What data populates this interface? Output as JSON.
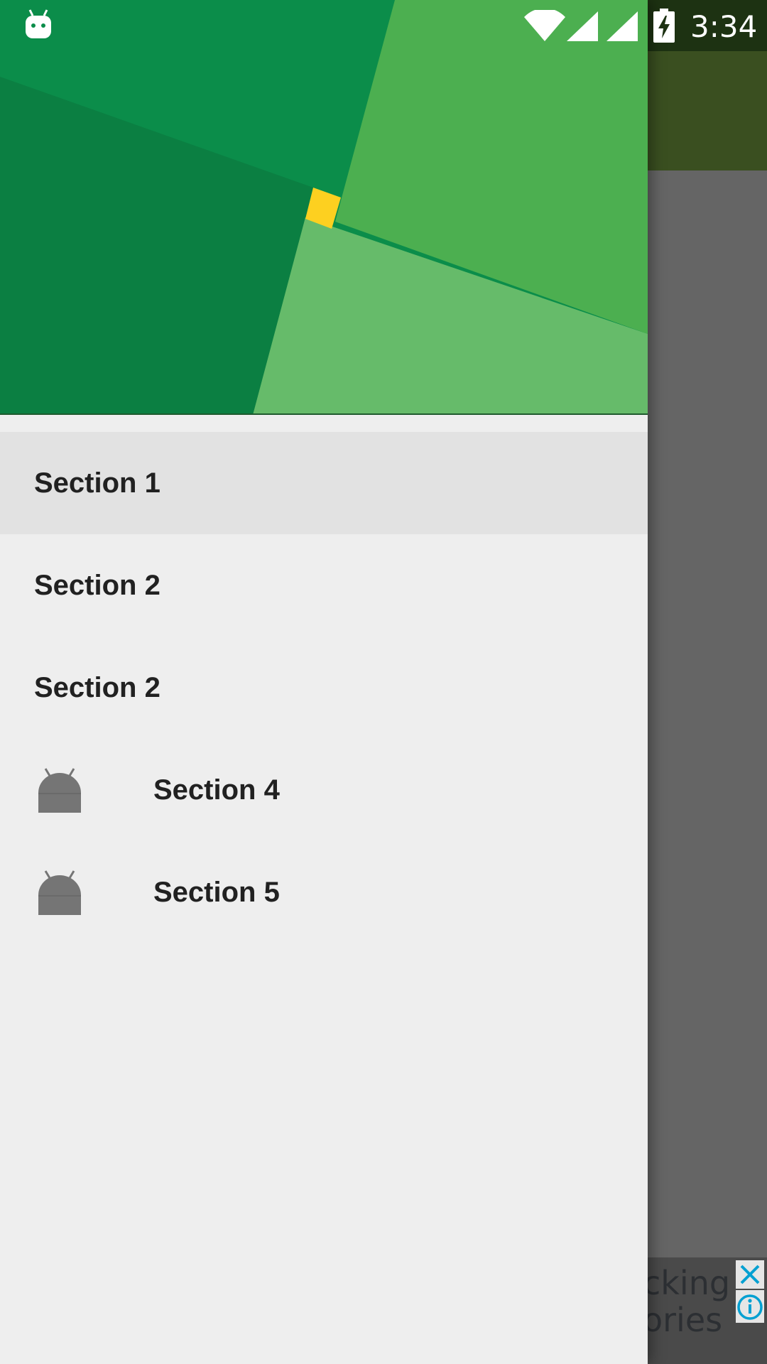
{
  "status_bar": {
    "time": "3:34",
    "icons": [
      "android-notification-icon",
      "wifi-icon",
      "signal-icon",
      "signal-icon",
      "battery-charging-icon"
    ]
  },
  "drawer": {
    "header_colors": {
      "dark_green": "#0b7f42",
      "mid_green": "#0b8d4a",
      "light_green": "#4caf50",
      "pale_green": "#66bb6a",
      "accent_yellow": "#fdd020"
    },
    "menu": [
      {
        "label": "Section 1",
        "selected": true,
        "icon": null
      },
      {
        "label": "Section 2",
        "selected": false,
        "icon": null
      },
      {
        "label": "Section 2",
        "selected": false,
        "icon": null
      },
      {
        "label": "Section 4",
        "selected": false,
        "icon": "android-icon"
      },
      {
        "label": "Section 5",
        "selected": false,
        "icon": "android-icon"
      }
    ]
  },
  "ad_banner": {
    "line1": "cking",
    "line2": "ories"
  },
  "colors": {
    "drawer_bg": "#eeeeee",
    "selected_bg": "#e2e2e2",
    "text": "#212121",
    "icon_gray": "#757575",
    "toolbar": "#3a4f20"
  }
}
